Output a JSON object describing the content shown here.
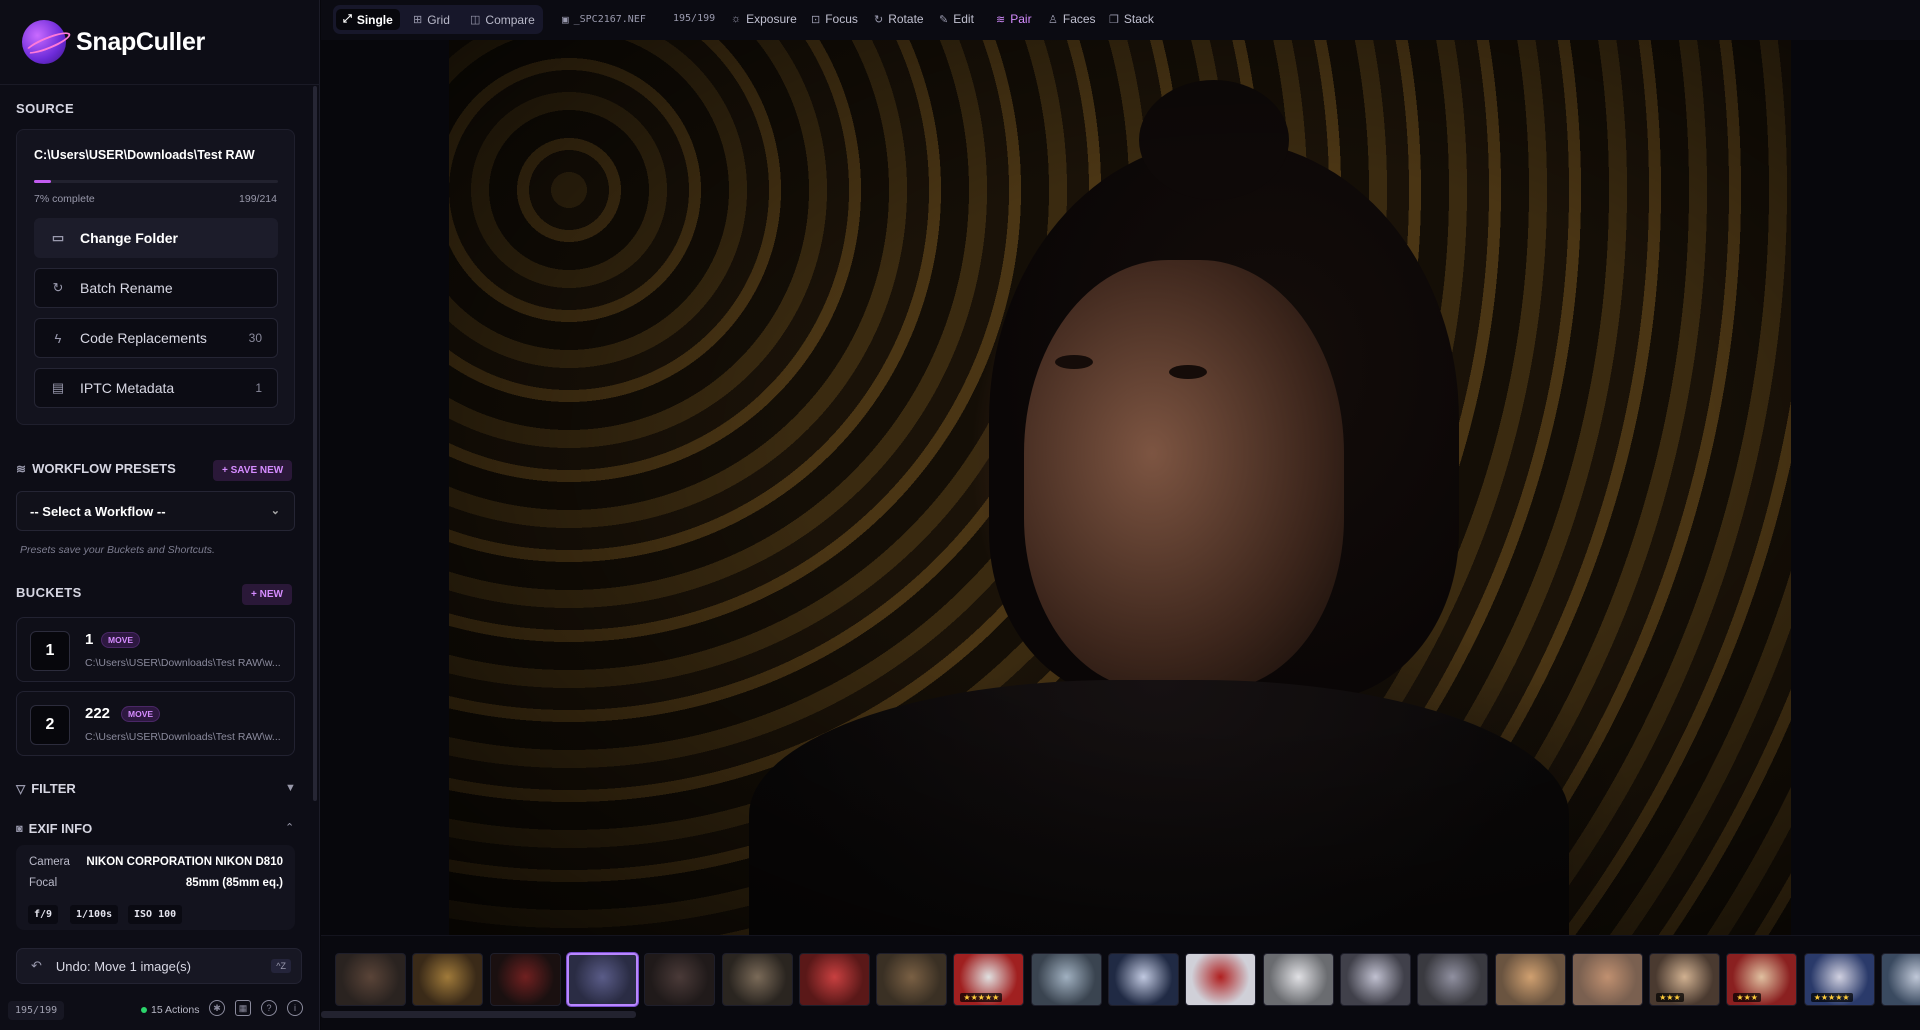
{
  "app": {
    "name": "SnapCuller"
  },
  "toolbar": {
    "view_modes": [
      {
        "label": "Single",
        "icon": "expand-icon",
        "active": true
      },
      {
        "label": "Grid",
        "icon": "grid-icon",
        "active": false
      },
      {
        "label": "Compare",
        "icon": "compare-icon",
        "active": false
      }
    ],
    "filename": "_SPC2167.NEF",
    "position": "195/199",
    "tools": [
      {
        "label": "Exposure",
        "icon": "sun-icon"
      },
      {
        "label": "Focus",
        "icon": "focus-icon"
      },
      {
        "label": "Rotate",
        "icon": "rotate-icon"
      },
      {
        "label": "Edit",
        "icon": "edit-icon"
      },
      {
        "label": "Pair",
        "icon": "layers-icon",
        "accent": true
      },
      {
        "label": "Faces",
        "icon": "person-icon"
      },
      {
        "label": "Stack",
        "icon": "stack-icon"
      }
    ]
  },
  "source": {
    "title": "SOURCE",
    "path": "C:\\Users\\USER\\Downloads\\Test RAW",
    "progress_percent": 7,
    "progress_text": "7% complete",
    "progress_count": "199/214",
    "buttons": [
      {
        "label": "Change Folder",
        "icon": "folder-icon",
        "count": ""
      },
      {
        "label": "Batch Rename",
        "icon": "refresh-icon",
        "count": ""
      },
      {
        "label": "Code Replacements",
        "icon": "lightning-icon",
        "count": "30"
      },
      {
        "label": "IPTC Metadata",
        "icon": "document-icon",
        "count": "1"
      }
    ]
  },
  "workflow": {
    "title": "WORKFLOW PRESETS",
    "save_label": "+ SAVE NEW",
    "select_value": "-- Select a Workflow --",
    "hint": "Presets save your Buckets and Shortcuts."
  },
  "buckets": {
    "title": "BUCKETS",
    "new_label": "+ NEW",
    "items": [
      {
        "key": "1",
        "name": "1",
        "badge": "MOVE",
        "path": "C:\\Users\\USER\\Downloads\\Test RAW\\w..."
      },
      {
        "key": "2",
        "name": "222",
        "badge": "MOVE",
        "path": "C:\\Users\\USER\\Downloads\\Test RAW\\w..."
      }
    ]
  },
  "filter": {
    "title": "FILTER"
  },
  "exif": {
    "title": "EXIF INFO",
    "camera_label": "Camera",
    "camera": "NIKON CORPORATION NIKON D810",
    "focal_label": "Focal",
    "focal": "85mm (85mm eq.)",
    "aperture": "f/9",
    "shutter": "1/100s",
    "iso": "ISO 100"
  },
  "footer": {
    "undo_label": "Undo: Move 1 image(s)",
    "undo_shortcut": "^Z",
    "count": "195/199",
    "actions": "15 Actions"
  },
  "filmstrip": {
    "thumbs": [
      {
        "tone": "#2a2320",
        "accent": "#5a4438",
        "stars": ""
      },
      {
        "tone": "#3a2a18",
        "accent": "#a07a3a",
        "stars": ""
      },
      {
        "tone": "#1a1010",
        "accent": "#702020",
        "stars": ""
      },
      {
        "tone": "#2a2c44",
        "accent": "#5a5c88",
        "stars": "",
        "selected": true
      },
      {
        "tone": "#201a1a",
        "accent": "#4a3a38",
        "stars": ""
      },
      {
        "tone": "#2a2520",
        "accent": "#7a6a58",
        "stars": ""
      },
      {
        "tone": "#5a1818",
        "accent": "#c84040",
        "stars": ""
      },
      {
        "tone": "#3a3024",
        "accent": "#7a6044",
        "stars": ""
      },
      {
        "tone": "#a02020",
        "accent": "#e0e0e0",
        "stars": "★★★★★"
      },
      {
        "tone": "#3a4450",
        "accent": "#a0b0c0",
        "stars": ""
      },
      {
        "tone": "#202a44",
        "accent": "#c0c8e0",
        "stars": ""
      },
      {
        "tone": "#d0d0d8",
        "accent": "#b02020",
        "stars": ""
      },
      {
        "tone": "#6a6c70",
        "accent": "#e0e0e4",
        "stars": ""
      },
      {
        "tone": "#40404a",
        "accent": "#c0c0d0",
        "stars": ""
      },
      {
        "tone": "#3a3a40",
        "accent": "#9090a0",
        "stars": ""
      },
      {
        "tone": "#6a5440",
        "accent": "#d0a070",
        "stars": ""
      },
      {
        "tone": "#7a6050",
        "accent": "#c09070",
        "stars": ""
      },
      {
        "tone": "#4a3a30",
        "accent": "#d0b090",
        "stars": "★★★"
      },
      {
        "tone": "#8a2020",
        "accent": "#e0c0a0",
        "stars": "★★★"
      },
      {
        "tone": "#2a3a6a",
        "accent": "#d0d0e0",
        "stars": "★★★★★"
      },
      {
        "tone": "#3a4a60",
        "accent": "#c0c8d8",
        "stars": ""
      }
    ]
  }
}
